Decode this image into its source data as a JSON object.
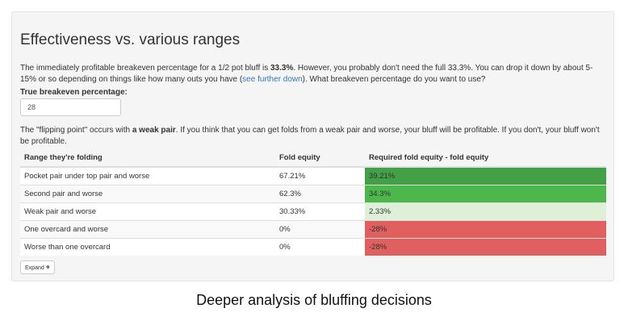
{
  "section": {
    "title": "Effectiveness vs. various ranges",
    "intro": {
      "part1": "The immediately profitable breakeven percentage for a 1/2 pot bluff is ",
      "bold_pct": "33.3%",
      "part2": ". However, you probably don't need the full 33.3%. You can drop it down by about 5-15% or so depending on things like how many outs you have (",
      "link_text": "see further down",
      "part3": "). What breakeven percentage do you want to use?"
    },
    "breakeven_label": "True breakeven percentage:",
    "breakeven_value": "28",
    "flip": {
      "part1": "The \"flipping point\" occurs with ",
      "bold": "a weak pair",
      "part2": ". If you think that you can get folds from a weak pair and worse, your bluff will be profitable. If you don't, your bluff won't be profitable."
    },
    "table": {
      "headers": [
        "Range they're folding",
        "Fold equity",
        "Required fold equity - fold equity"
      ],
      "rows": [
        {
          "range": "Pocket pair under top pair and worse",
          "fold_equity": "67.21%",
          "diff": "39.21%",
          "diff_color": "#43a047"
        },
        {
          "range": "Second pair and worse",
          "fold_equity": "62.3%",
          "diff": "34.3%",
          "diff_color": "#4cb84c"
        },
        {
          "range": "Weak pair and worse",
          "fold_equity": "30.33%",
          "diff": "2.33%",
          "diff_color": "#dff0d8"
        },
        {
          "range": "One overcard and worse",
          "fold_equity": "0%",
          "diff": "-28%",
          "diff_color": "#e06060"
        },
        {
          "range": "Worse than one overcard",
          "fold_equity": "0%",
          "diff": "-28%",
          "diff_color": "#e06060"
        }
      ]
    },
    "expand_label": "Expand",
    "expand_icon": "plus-icon"
  },
  "caption": "Deeper analysis of bluffing decisions"
}
